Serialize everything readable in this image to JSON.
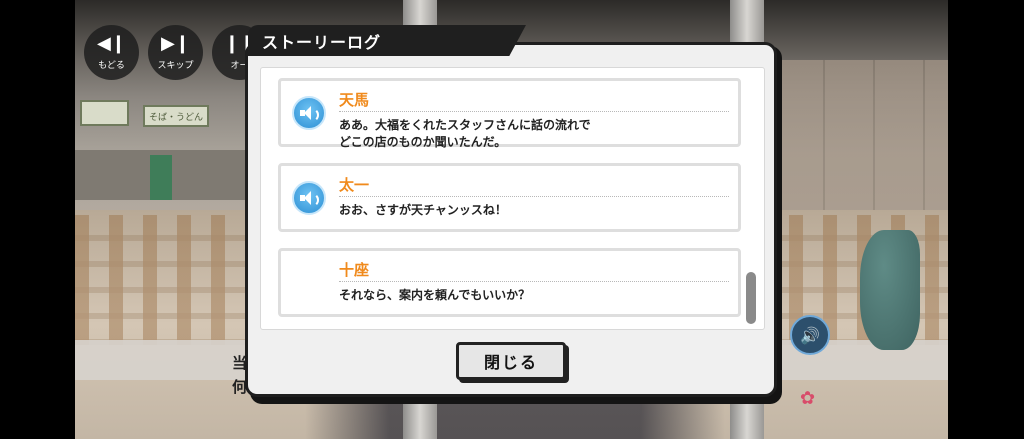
{
  "controls": [
    {
      "label": "もどる",
      "icon": "rewind-icon"
    },
    {
      "label": "スキップ",
      "icon": "skip-icon"
    },
    {
      "label": "オー",
      "icon": "auto-icon"
    }
  ],
  "background_signs": [
    "そば・うどん"
  ],
  "background_text": [
    "当",
    "何"
  ],
  "modal": {
    "title": "ストーリーログ",
    "close_label": "閉じる",
    "entries": [
      {
        "speaker": "天馬",
        "text": "ああ。大福をくれたスタッフさんに話の流れで\nどこの店のものか聞いたんだ。",
        "has_voice": true
      },
      {
        "speaker": "太一",
        "text": "おお、さすが天チャンッスね！",
        "has_voice": true
      },
      {
        "speaker": "十座",
        "text": "それなら、案内を頼んでもいいか？",
        "has_voice": false
      }
    ]
  },
  "colors": {
    "speaker_name": "#f08a1c",
    "voice_button": "#2d8fd4",
    "title_bar": "#1f1f1f"
  }
}
